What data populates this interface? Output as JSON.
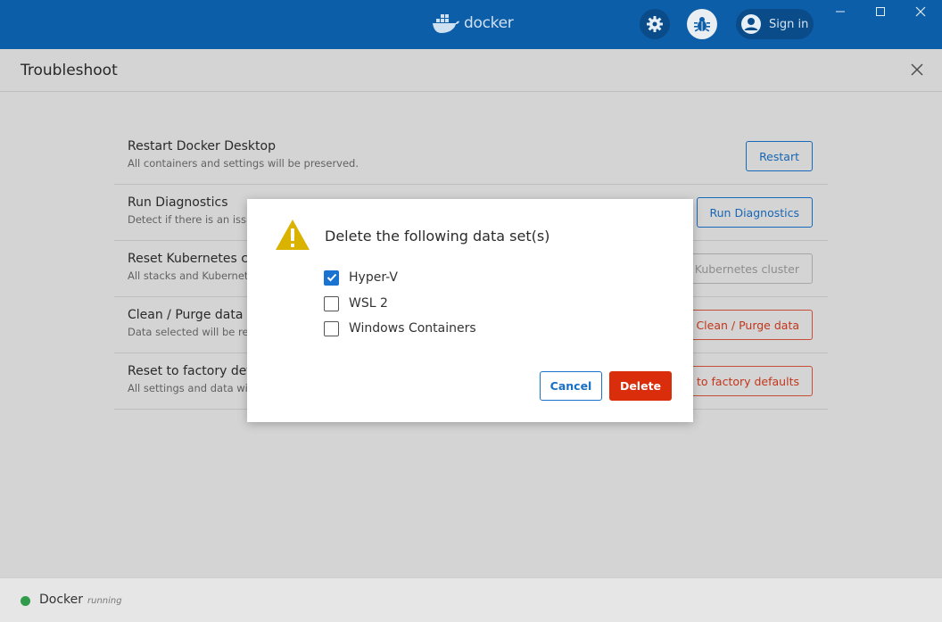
{
  "titlebar": {
    "brand": "docker",
    "signin_label": "Sign in"
  },
  "header": {
    "title": "Troubleshoot"
  },
  "rows": [
    {
      "title": "Restart Docker Desktop",
      "desc": "All containers and settings will be preserved.",
      "button": "Restart"
    },
    {
      "title": "Run Diagnostics",
      "desc": "Detect if there is an issu",
      "button": "Run Diagnostics"
    },
    {
      "title": "Reset Kubernetes clu",
      "desc": "All stacks and Kubernete",
      "button": "t Kubernetes cluster"
    },
    {
      "title": "Clean / Purge data",
      "desc": "Data selected will be ren",
      "button": "Clean / Purge data"
    },
    {
      "title": "Reset to factory defa",
      "desc": "All settings and data will",
      "button": "et to factory defaults"
    }
  ],
  "dialog": {
    "title": "Delete the following data set(s)",
    "options": [
      {
        "label": "Hyper-V",
        "checked": true
      },
      {
        "label": "WSL 2",
        "checked": false
      },
      {
        "label": "Windows Containers",
        "checked": false
      }
    ],
    "cancel_label": "Cancel",
    "delete_label": "Delete"
  },
  "status": {
    "name": "Docker",
    "state": "running"
  },
  "colors": {
    "titlebar": "#0d5ea8",
    "accent": "#1a73c9",
    "danger": "#d92d0b",
    "running": "#2f9b4b"
  }
}
